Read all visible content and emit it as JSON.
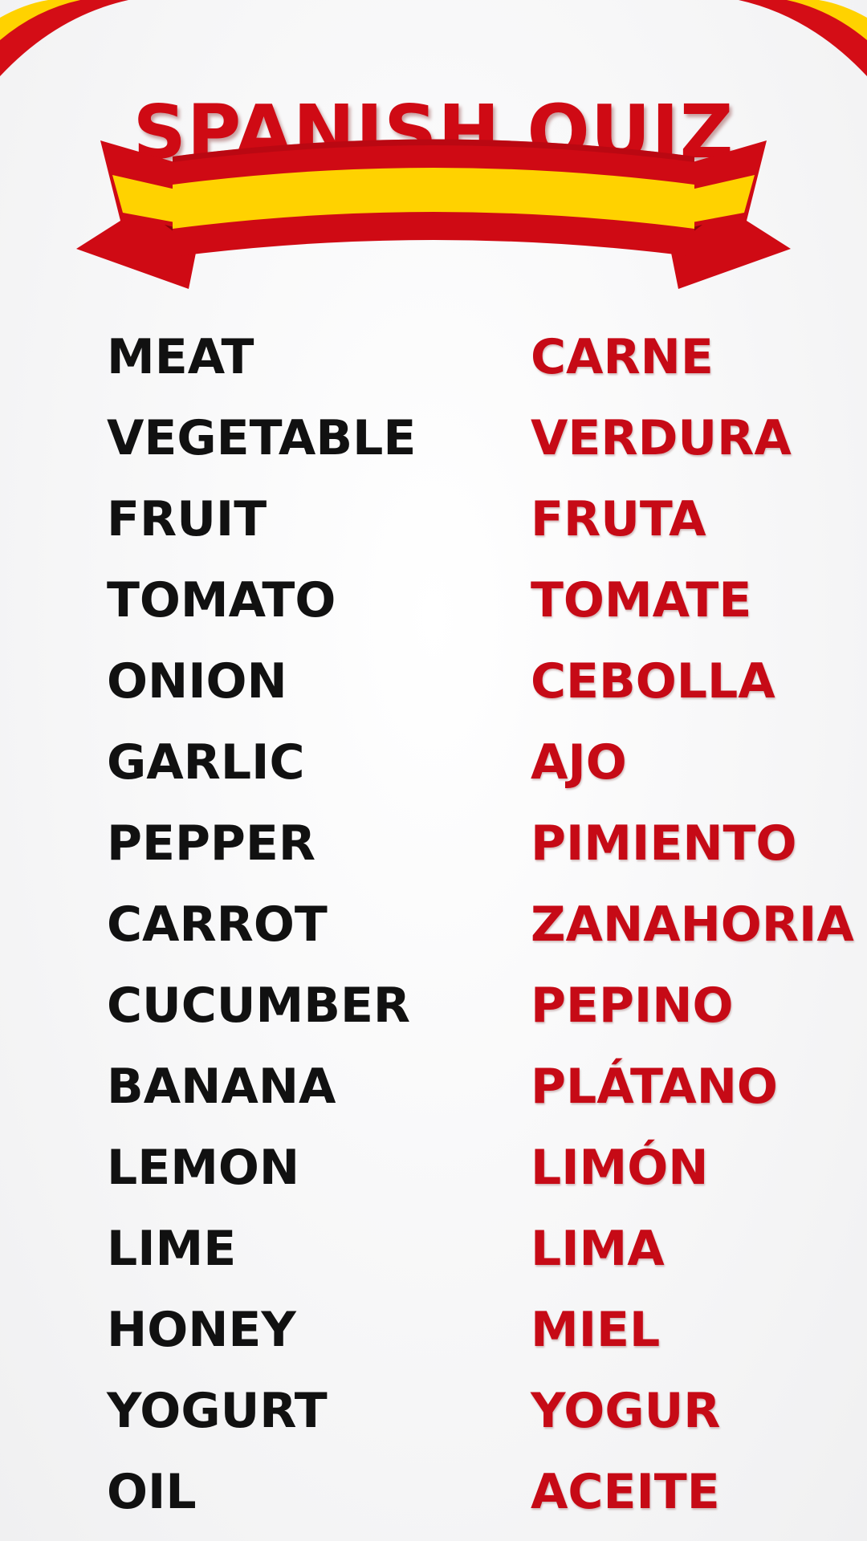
{
  "title": "SPANISH QUIZ",
  "colors": {
    "red": "#cf0a14",
    "yellow": "#ffd200",
    "english_text": "#111111",
    "spanish_text": "#c60a16",
    "background": "#f7f7f8"
  },
  "decorations": {
    "ribbon": "spanish-flag-ribbon",
    "corners": "red-yellow-arc"
  },
  "vocabulary": [
    {
      "en": "MEAT",
      "es": "CARNE"
    },
    {
      "en": "VEGETABLE",
      "es": "VERDURA"
    },
    {
      "en": "FRUIT",
      "es": "FRUTA"
    },
    {
      "en": "TOMATO",
      "es": "TOMATE"
    },
    {
      "en": "ONION",
      "es": "CEBOLLA"
    },
    {
      "en": "GARLIC",
      "es": "AJO"
    },
    {
      "en": "PEPPER",
      "es": "PIMIENTO"
    },
    {
      "en": "CARROT",
      "es": "ZANAHORIA"
    },
    {
      "en": "CUCUMBER",
      "es": "PEPINO"
    },
    {
      "en": "BANANA",
      "es": "PLÁTANO"
    },
    {
      "en": "LEMON",
      "es": "LIMÓN"
    },
    {
      "en": "LIME",
      "es": "LIMA"
    },
    {
      "en": "HONEY",
      "es": "MIEL"
    },
    {
      "en": "YOGURT",
      "es": "YOGUR"
    },
    {
      "en": "OIL",
      "es": "ACEITE"
    }
  ]
}
